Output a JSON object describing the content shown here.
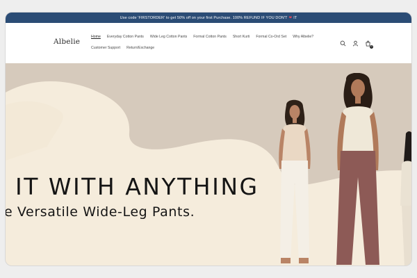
{
  "announcement": {
    "text_before": "Use code 'FIRSTORDER' to get 50% off on your first Purchase. 100% REFUND IF YOU DON'T",
    "heart": "❤",
    "text_after": "IT"
  },
  "brand": {
    "logo": "Albelie"
  },
  "nav": {
    "items": [
      "Home",
      "Everyday Cotton Pants",
      "Wide Leg Cotton Pants",
      "Formal Cotton Pants",
      "Short Kurti",
      "Formal Co-Ord Set",
      "Why Albelie?",
      "Customer Support",
      "Return/Exchange"
    ],
    "active": "Home"
  },
  "header_icons": [
    "search-icon",
    "account-icon",
    "cart-icon"
  ],
  "cart": {
    "count": "0"
  },
  "hero": {
    "headline": "IT WITH ANYTHING",
    "subline": "e Versatile Wide-Leg Pants."
  },
  "colors": {
    "announcement_bg": "#2b4c75",
    "hero_bg": "#d6cabc",
    "hero_cream": "#f5ecdc"
  }
}
